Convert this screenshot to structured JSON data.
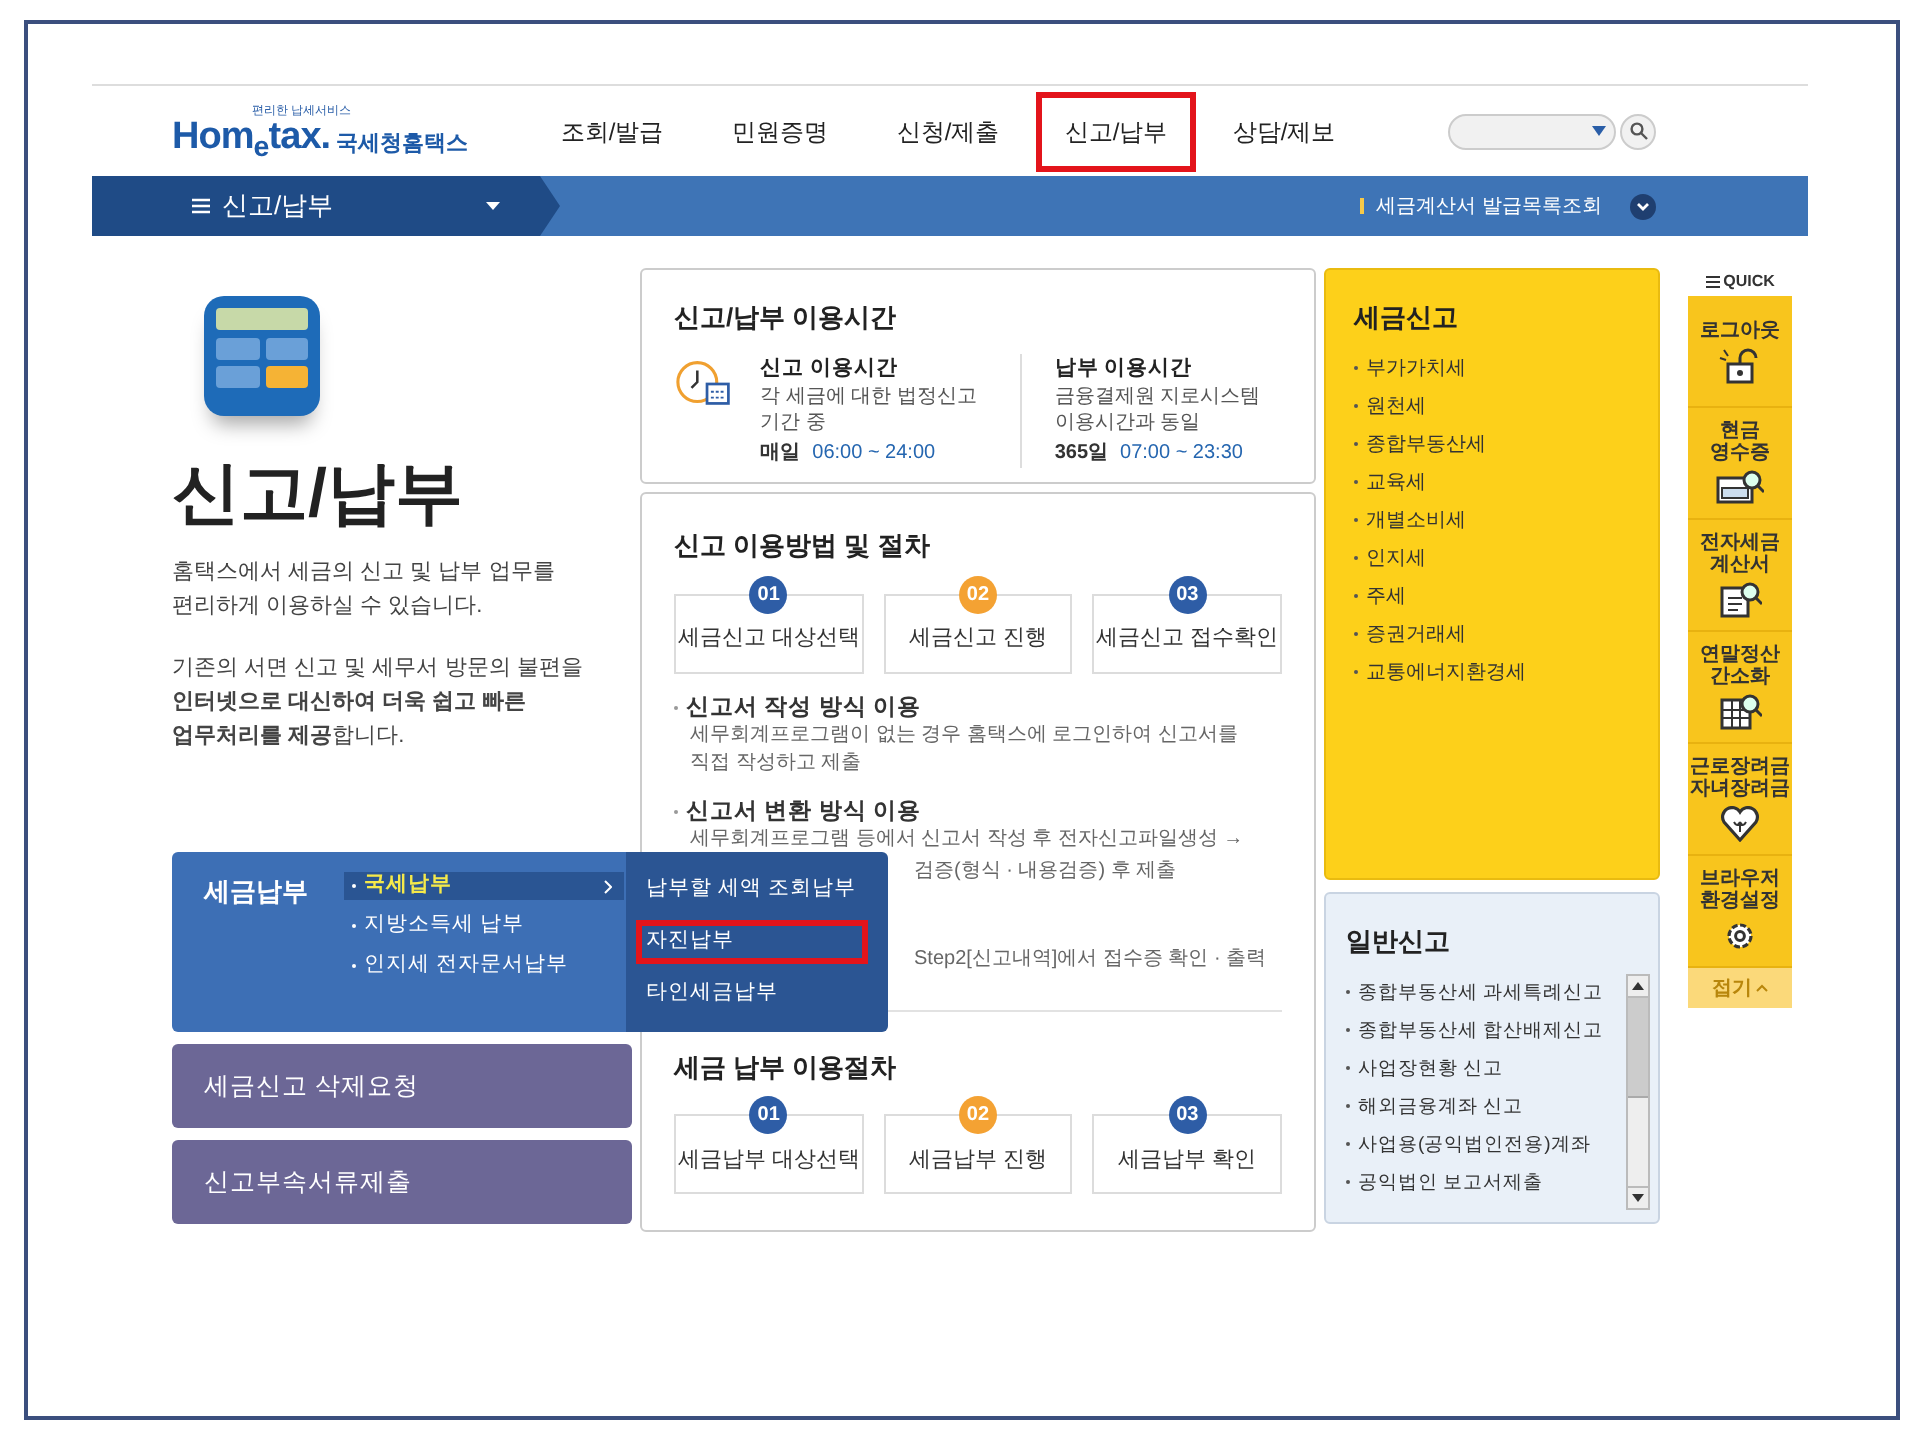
{
  "header": {
    "logo_tagline": "편리한 납세서비스",
    "logo_text": "Hom$_{e}$tax.",
    "logo_subtitle": "국세청홈택스",
    "menu": [
      {
        "label": "조회/발급",
        "highlighted": false
      },
      {
        "label": "민원증명",
        "highlighted": false
      },
      {
        "label": "신청/제출",
        "highlighted": false
      },
      {
        "label": "신고/납부",
        "highlighted": true
      },
      {
        "label": "상담/제보",
        "highlighted": false
      }
    ]
  },
  "breadcrumb_bar": {
    "menu_label": "신고/납부",
    "link": "세금계산서 발급목록조회"
  },
  "intro": {
    "title": "신고/납부",
    "paragraphs": [
      "홈택스에서 세금의 신고 및 납부 업무를 편리하게 이용하실 수 있습니다.",
      "기존의 서면 신고 및 세무서 방문의 불편을 **인터넷으로 대신하여 더욱 쉽고 빠른 업무처리를 제공**합니다."
    ]
  },
  "payment_menu": {
    "title": "세금납부",
    "items": [
      {
        "label": "국세납부",
        "selected": true
      },
      {
        "label": "지방소득세 납부",
        "selected": false
      },
      {
        "label": "인지세 전자문서납부",
        "selected": false
      }
    ],
    "submenu": [
      {
        "label": "납부할 세액 조회납부",
        "highlighted": false
      },
      {
        "label": "자진납부",
        "highlighted": true
      },
      {
        "label": "타인세금납부",
        "highlighted": false
      }
    ]
  },
  "side_buttons": [
    "세금신고 삭제요청",
    "신고부속서류제출"
  ],
  "hours_card": {
    "title": "신고/납부 이용시간",
    "columns": [
      {
        "title": "신고 이용시간",
        "desc": "각 세금에 대한 법정신고 기간 중",
        "day": "매일",
        "time": "06:00 ~ 24:00"
      },
      {
        "title": "납부 이용시간",
        "desc": "금융결제원 지로시스템 이용시간과 동일",
        "day": "365일",
        "time": "07:00 ~ 23:30"
      }
    ]
  },
  "filing_procedure": {
    "title": "신고 이용방법 및 절차",
    "steps": [
      {
        "number": "01",
        "label": "세금신고 대상선택",
        "color": "#2e5da6"
      },
      {
        "number": "02",
        "label": "세금신고 진행",
        "color": "#f4a233"
      },
      {
        "number": "03",
        "label": "세금신고 접수확인",
        "color": "#2e5da6"
      }
    ],
    "methods": [
      {
        "title": "신고서 작성 방식 이용",
        "text": "세무회계프로그램이 없는 경우 홈택스에 로그인하여 신고서를 직접 작성하고 제출"
      },
      {
        "title": "신고서 변환 방식 이용",
        "text": "세무회계프로그램 등에서 신고서 작성 후 전자신고파일생성 →",
        "fragments": [
          "검증(형식 · 내용검증) 후 제출",
          "Step2[신고내역]에서 접수증 확인 · 출력"
        ]
      }
    ]
  },
  "payment_procedure": {
    "title": "세금 납부 이용절차",
    "steps": [
      {
        "number": "01",
        "label": "세금납부 대상선택",
        "color": "#2e5da6"
      },
      {
        "number": "02",
        "label": "세금납부 진행",
        "color": "#f4a233"
      },
      {
        "number": "03",
        "label": "세금납부 확인",
        "color": "#2e5da6"
      }
    ]
  },
  "tax_filing": {
    "title": "세금신고",
    "items": [
      "부가가치세",
      "원천세",
      "종합부동산세",
      "교육세",
      "개별소비세",
      "인지세",
      "주세",
      "증권거래세",
      "교통에너지환경세"
    ]
  },
  "general_filing": {
    "title": "일반신고",
    "items": [
      "종합부동산세 과세특례신고",
      "종합부동산세 합산배제신고",
      "사업장현황 신고",
      "해외금융계좌 신고",
      "사업용(공익법인전용)계좌",
      "공익법인 보고서제출"
    ]
  },
  "quick_menu": {
    "title": "QUICK",
    "items": [
      {
        "label": "로그아웃",
        "kind": "logout"
      },
      {
        "label": "현금 영수증",
        "kind": "receipt"
      },
      {
        "label": "전자세금 계산서",
        "kind": "invoice"
      },
      {
        "label": "연말정산 간소화",
        "kind": "yearend"
      },
      {
        "label": "근로장려금 자녀장려금",
        "kind": "incentive"
      },
      {
        "label": "브라우저 환경설정",
        "kind": "settings"
      }
    ],
    "collapse": "접기"
  }
}
